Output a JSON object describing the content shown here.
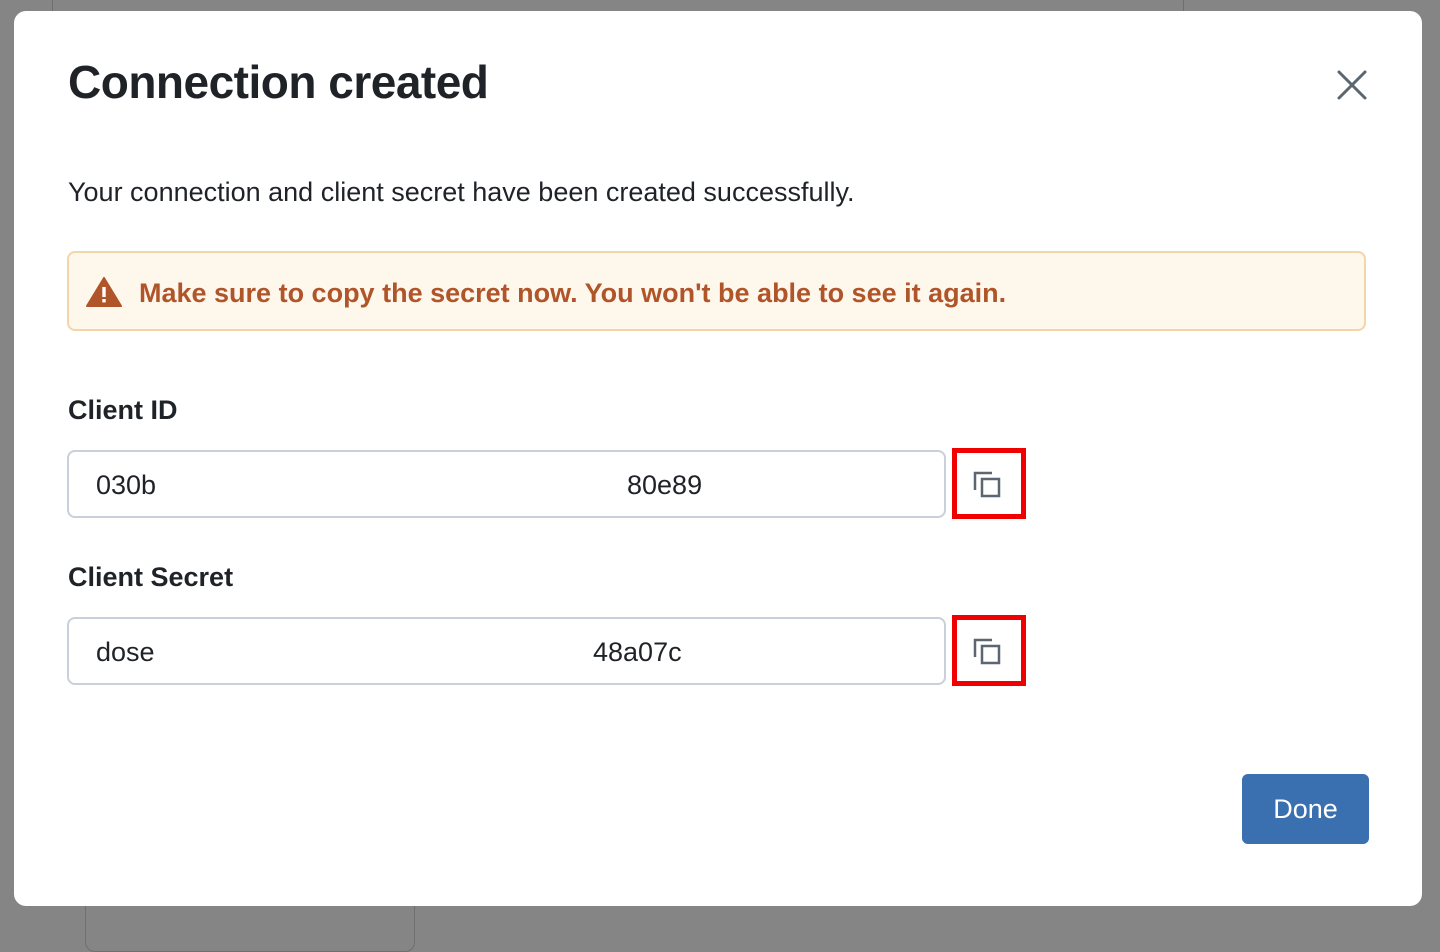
{
  "modal": {
    "title": "Connection created",
    "description": "Your connection and client secret have been created successfully.",
    "warning": "Make sure to copy the secret now. You won't be able to see it again.",
    "client_id": {
      "label": "Client ID",
      "value_start": "030b",
      "value_end": "80e89"
    },
    "client_secret": {
      "label": "Client Secret",
      "value_start": "dose",
      "value_end": "48a07c"
    },
    "done_label": "Done"
  },
  "colors": {
    "accent": "#3a6fb0",
    "warning_text": "#b0552a",
    "warning_bg": "#fef7ec",
    "highlight": "#f00000"
  }
}
